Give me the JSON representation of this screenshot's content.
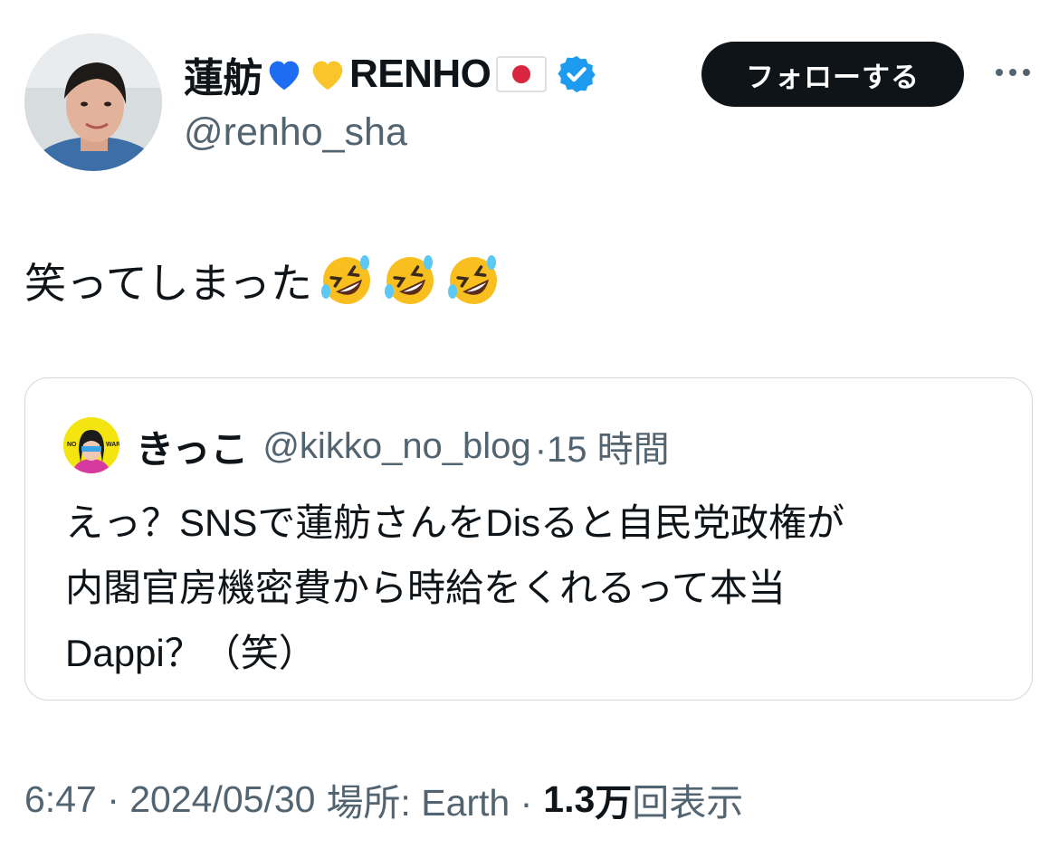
{
  "author": {
    "display_name_prefix": "蓮舫",
    "display_name_suffix": "RENHO",
    "handle": "@renho_sha",
    "verified": true,
    "heart_colors": [
      "#1d6cf2",
      "#f9c52b"
    ]
  },
  "header": {
    "follow_label": "フォローする",
    "more_icon": "more-horizontal-icon"
  },
  "tweet": {
    "text": "笑ってしまった",
    "emoji": [
      "rolling-on-floor-laughing",
      "rolling-on-floor-laughing",
      "rolling-on-floor-laughing"
    ]
  },
  "quote": {
    "name": "きっこ",
    "handle": "@kikko_no_blog",
    "time": "·15 時間",
    "text": "えっ？SNSで蓮舫さんをDisると自民党政権が\n内閣官房機密費から時給をくれるって本当\nDappi？（笑）"
  },
  "meta": {
    "time": "6:47 · 2024/05/30",
    "location": "場所: Earth ·",
    "views_count": "1.3",
    "views_unit": "万",
    "views_label": "回表示"
  },
  "colors": {
    "accent": "#1d9bf0",
    "text": "#0f1419",
    "secondary": "#536471",
    "border": "#cfd9de"
  }
}
